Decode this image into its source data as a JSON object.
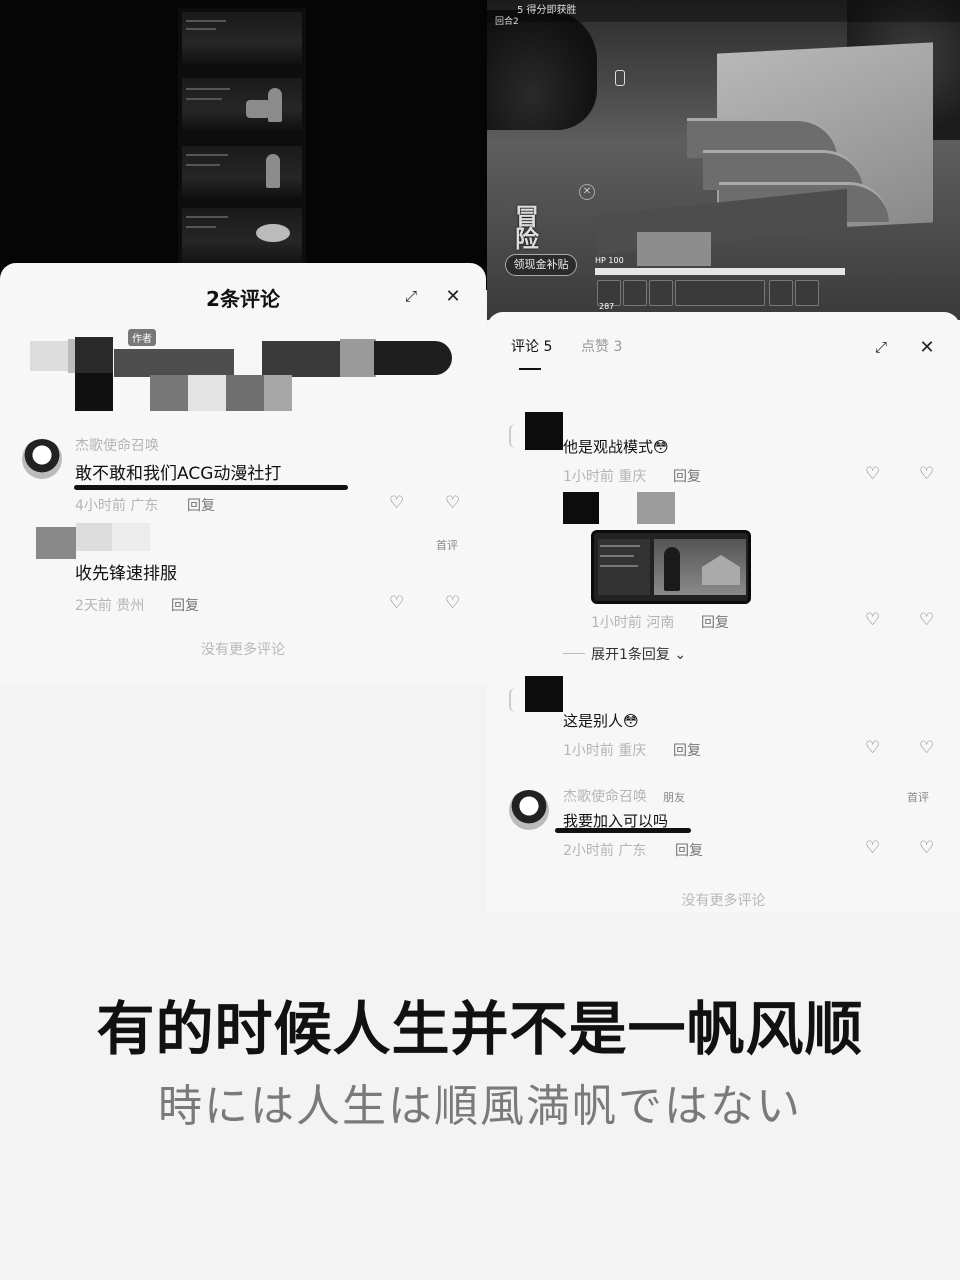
{
  "game": {
    "top_text": "5 得分即获胜",
    "round_label": "回合2",
    "subsidy_button": "领现金补贴",
    "hp_label": "HP 100",
    "hp_percent": 100,
    "ammo": "287"
  },
  "left_panel": {
    "title": "2条评论",
    "author_tag": "作者",
    "comments": [
      {
        "name": "杰歌使命召唤",
        "text": "敢不敢和我们ACG动漫社打",
        "time": "4小时前 广东",
        "reply": "回复",
        "tag": ""
      },
      {
        "name": "",
        "text": "收先锋速排服",
        "time": "2天前 贵州",
        "reply": "回复",
        "tag": "首评"
      }
    ],
    "no_more": "没有更多评论"
  },
  "right_panel": {
    "tabs": [
      {
        "label": "评论 5",
        "active": true
      },
      {
        "label": "点赞 3",
        "active": false
      }
    ],
    "comments": [
      {
        "text": "他是观战模式😳",
        "time": "1小时前 重庆",
        "reply": "回复"
      },
      {
        "text": "",
        "time": "1小时前 河南",
        "reply": "回复",
        "expand": "展开1条回复"
      },
      {
        "text": "这是别人😳",
        "time": "1小时前 重庆",
        "reply": "回复"
      },
      {
        "name": "杰歌使命召唤",
        "badge": "朋友",
        "tag": "首评",
        "text": "我要加入可以吗",
        "time": "2小时前 广东",
        "reply": "回复"
      }
    ],
    "no_more": "没有更多评论"
  },
  "caption": {
    "main": "有的时候人生并不是一帆风顺",
    "sub": "時には人生は順風満帆ではない"
  },
  "icons": {
    "expand": "expand-icon",
    "close": "close-icon",
    "like": "heart-icon",
    "dislike": "broken-heart-icon"
  },
  "colors": {
    "panel_bg": "#f7f7f7",
    "page_bg": "#f3f3f3",
    "muted_text": "#b5b5b5"
  }
}
